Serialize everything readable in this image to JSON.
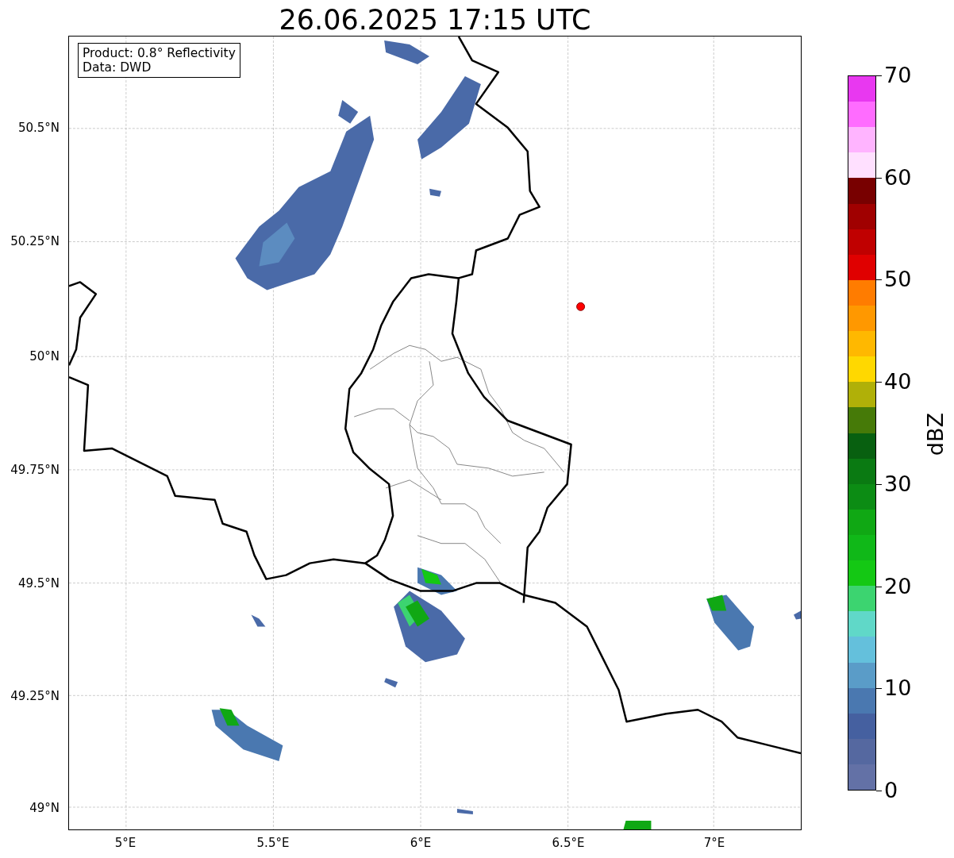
{
  "title": "26.06.2025 17:15 UTC",
  "info_box": {
    "lines": [
      "Product: 0.8° Reflectivity",
      "Data: DWD"
    ]
  },
  "axes": {
    "lat_labels": [
      "50.5°N",
      "50.25°N",
      "50°N",
      "49.75°N",
      "49.5°N",
      "49.25°N",
      "49°N"
    ],
    "lon_labels": [
      "5°E",
      "5.5°E",
      "6°E",
      "6.5°E",
      "7°E"
    ]
  },
  "colorbar": {
    "label": "dBZ",
    "ticks": [
      "70",
      "60",
      "50",
      "40",
      "30",
      "20",
      "10",
      "0"
    ],
    "segments": [
      {
        "color": "#e838f0"
      },
      {
        "color": "#ff6cff"
      },
      {
        "color": "#ffb4ff"
      },
      {
        "color": "#ffe0ff"
      },
      {
        "color": "#780000"
      },
      {
        "color": "#a00000"
      },
      {
        "color": "#c00000"
      },
      {
        "color": "#e00000"
      },
      {
        "color": "#ff7c00"
      },
      {
        "color": "#ff9800"
      },
      {
        "color": "#ffb800"
      },
      {
        "color": "#ffd800"
      },
      {
        "color": "#b0b008"
      },
      {
        "color": "#467a08"
      },
      {
        "color": "#086010"
      },
      {
        "color": "#0a7a12"
      },
      {
        "color": "#0c8c14"
      },
      {
        "color": "#10a814"
      },
      {
        "color": "#10b818"
      },
      {
        "color": "#14c814"
      },
      {
        "color": "#3cd470"
      },
      {
        "color": "#60d8c8"
      },
      {
        "color": "#64c0dc"
      },
      {
        "color": "#5a9cc8"
      },
      {
        "color": "#4a78b0"
      },
      {
        "color": "#4560a0"
      },
      {
        "color": "#5568a0"
      },
      {
        "color": "#6371a6"
      }
    ]
  }
}
